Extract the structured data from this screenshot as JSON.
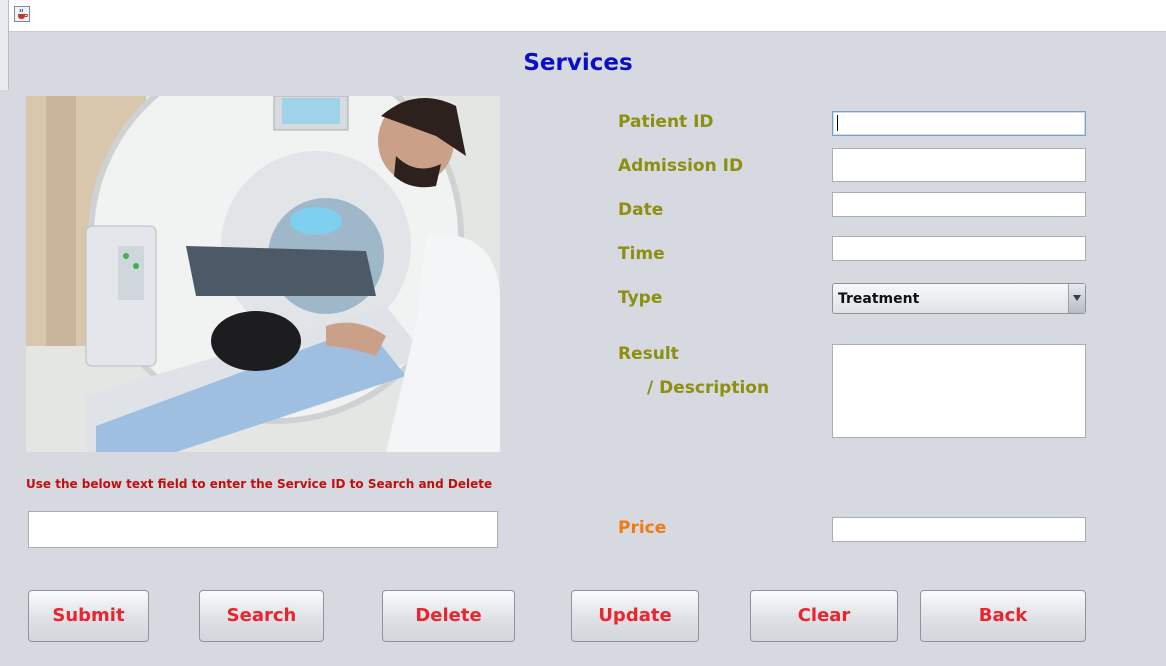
{
  "window": {
    "app_icon": "java-coffee-icon"
  },
  "page": {
    "title": "Services"
  },
  "image": {
    "description_icon": "ct-scanner-photo"
  },
  "form": {
    "patient_id_label": "Patient ID",
    "admission_id_label": "Admission ID",
    "date_label": "Date",
    "time_label": "Time",
    "type_label": "Type",
    "type_value": "Treatment",
    "result_label": "Result",
    "description_label": "/ Description",
    "price_label": "Price",
    "patient_id_value": "",
    "admission_id_value": "",
    "date_value": "",
    "time_value": "",
    "result_value": "",
    "price_value": ""
  },
  "search": {
    "hint": "Use the below text field to  enter the Service ID  to Search and Delete",
    "value": ""
  },
  "buttons": {
    "submit": "Submit",
    "search": "Search",
    "delete": "Delete",
    "update": "Update",
    "clear": "Clear",
    "back": "Back"
  },
  "colors": {
    "heading": "#0a0fc6",
    "label": "#8c8f10",
    "price_label": "#f27a12",
    "hint": "#c20e0e",
    "button_text": "#e8262f",
    "background": "#d6d9e0"
  }
}
